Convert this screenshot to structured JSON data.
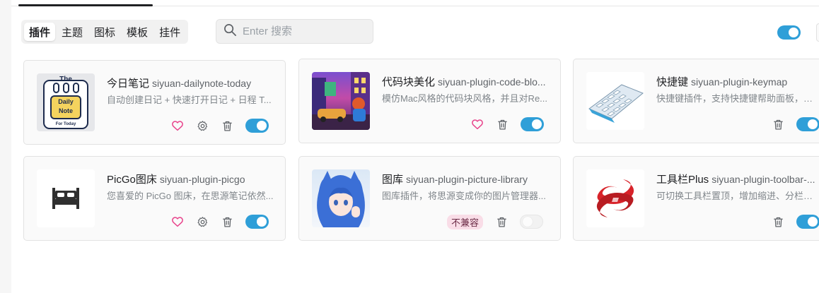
{
  "colors": {
    "accent": "#2f9fd8",
    "heart": "#e8438b",
    "badge_bg": "#f9dde7"
  },
  "tabs": [
    {
      "label": "插件",
      "active": true
    },
    {
      "label": "主题",
      "active": false
    },
    {
      "label": "图标",
      "active": false
    },
    {
      "label": "模板",
      "active": false
    },
    {
      "label": "挂件",
      "active": false
    }
  ],
  "search": {
    "placeholder": "Enter 搜索",
    "value": "",
    "icon": "search-icon"
  },
  "global_toggle": {
    "on": true
  },
  "plugins": [
    {
      "name": "今日笔记",
      "package": "siyuan-dailynote-today",
      "description": "自动创建日记 + 快速打开日记 + 日程 T...",
      "enabled": true,
      "thumb": {
        "line1": "The",
        "line2": "Daily",
        "line3": "Note",
        "line4": "For Today"
      }
    },
    {
      "name": "代码块美化",
      "package": "siyuan-plugin-code-blo...",
      "description": "模仿Mac风格的代码块风格，并且对Re...",
      "enabled": true
    },
    {
      "name": "快捷键",
      "package": "siyuan-plugin-keymap",
      "description": "快捷键插件，支持快捷键帮助面板，支...",
      "enabled": true
    },
    {
      "name": "PicGo图床",
      "package": "siyuan-plugin-picgo",
      "description": "您喜爱的 PicGo 图床，在思源笔记依然...",
      "enabled": true
    },
    {
      "name": "图库",
      "package": "siyuan-plugin-picture-library",
      "description": "图库插件，将思源变成你的图片管理器...",
      "enabled": false,
      "badge": "不兼容"
    },
    {
      "name": "工具栏Plus",
      "package": "siyuan-plugin-toolbar-...",
      "description": "可切换工具栏置顶，增加缩进、分栏等...",
      "enabled": true
    }
  ]
}
